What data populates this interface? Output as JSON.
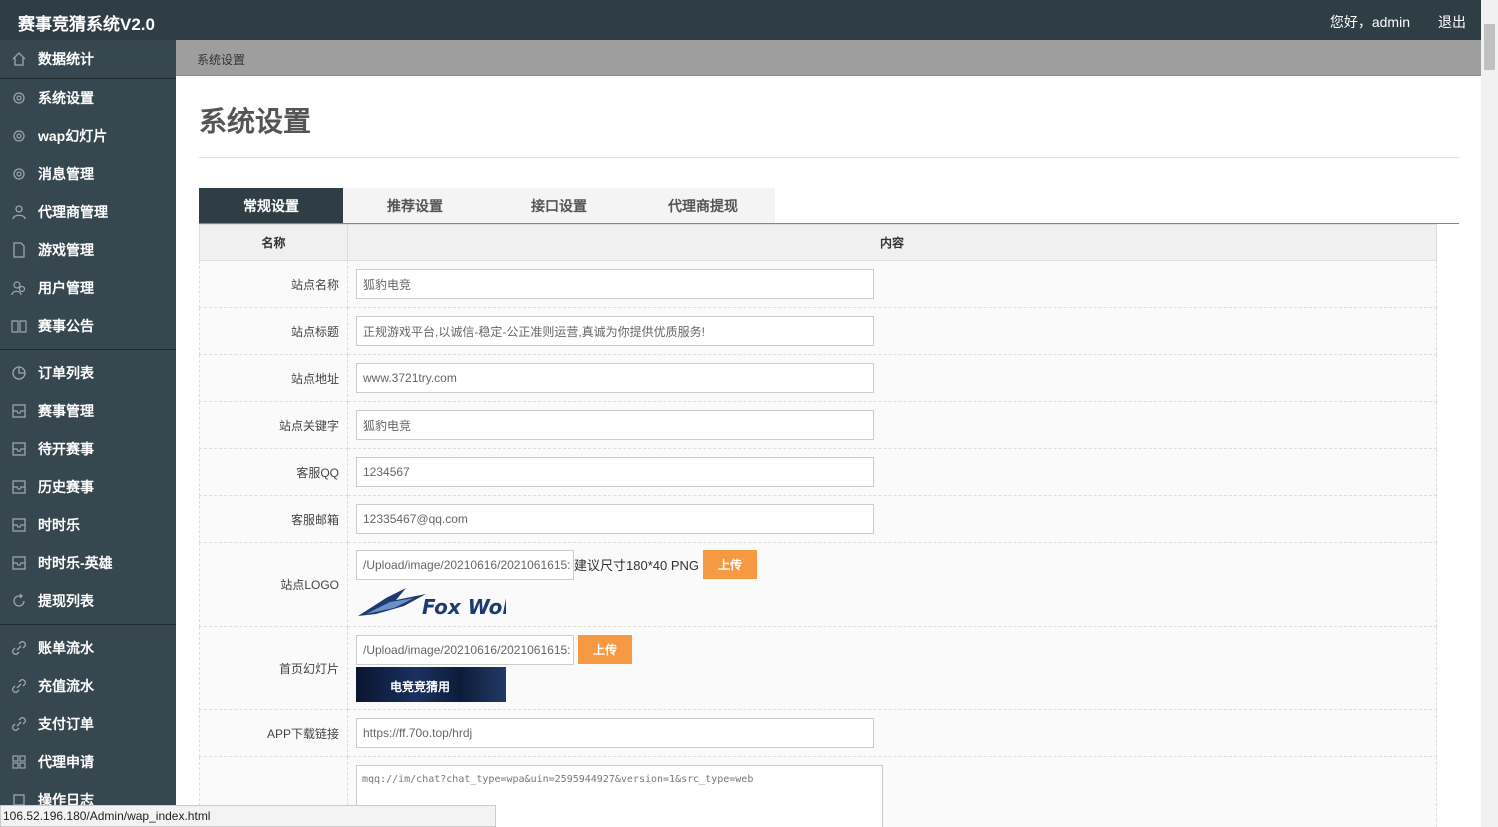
{
  "header": {
    "brand": "赛事竞猜系统V2.0",
    "greeting": "您好，admin",
    "logout": "退出"
  },
  "sidebar": {
    "groups": [
      [
        {
          "label": "数据统计",
          "icon": "home-icon"
        }
      ],
      [
        {
          "label": "系统设置",
          "icon": "gear-icon"
        },
        {
          "label": "wap幻灯片",
          "icon": "gear-icon"
        },
        {
          "label": "消息管理",
          "icon": "gear-icon"
        },
        {
          "label": "代理商管理",
          "icon": "user-icon"
        },
        {
          "label": "游戏管理",
          "icon": "file-icon"
        },
        {
          "label": "用户管理",
          "icon": "users-icon"
        },
        {
          "label": "赛事公告",
          "icon": "book-icon"
        }
      ],
      [
        {
          "label": "订单列表",
          "icon": "pie-icon"
        },
        {
          "label": "赛事管理",
          "icon": "tray-icon"
        },
        {
          "label": "待开赛事",
          "icon": "tray-icon"
        },
        {
          "label": "历史赛事",
          "icon": "tray-icon"
        },
        {
          "label": "时时乐",
          "icon": "tray-icon"
        },
        {
          "label": "时时乐-英雄",
          "icon": "tray-icon"
        },
        {
          "label": "提现列表",
          "icon": "refresh-icon"
        }
      ],
      [
        {
          "label": "账单流水",
          "icon": "link-icon"
        },
        {
          "label": "充值流水",
          "icon": "link-icon"
        },
        {
          "label": "支付订单",
          "icon": "link-icon"
        },
        {
          "label": "代理申请",
          "icon": "grid-icon"
        },
        {
          "label": "操作日志",
          "icon": "square-icon"
        }
      ]
    ]
  },
  "breadcrumb": "系统设置",
  "page_title": "系统设置",
  "tabs": [
    "常规设置",
    "推荐设置",
    "接口设置",
    "代理商提现"
  ],
  "table": {
    "col_name": "名称",
    "col_content": "内容",
    "site_name": {
      "label": "站点名称",
      "value": "狐豹电竞"
    },
    "site_title": {
      "label": "站点标题",
      "value": "正规游戏平台,以诚信-稳定-公正准则运营,真诚为你提供优质服务!"
    },
    "site_url": {
      "label": "站点地址",
      "value": "www.3721try.com"
    },
    "site_keywords": {
      "label": "站点关键字",
      "value": "狐豹电竞"
    },
    "service_qq": {
      "label": "客服QQ",
      "value": "1234567"
    },
    "service_email": {
      "label": "客服邮箱",
      "value": "12335467@qq.com"
    },
    "site_logo": {
      "label": "站点LOGO",
      "path": "/Upload/image/20210616/2021061615:",
      "hint": "建议尺寸180*40 PNG",
      "upload": "上传",
      "logo_text": "Fox Wolf"
    },
    "home_slide": {
      "label": "首页幻灯片",
      "path": "/Upload/image/20210616/2021061615:",
      "upload": "上传",
      "banner_text": "电竞竞猜用"
    },
    "app_link": {
      "label": "APP下载链接",
      "value": "https://ff.70o.top/hrdj"
    },
    "qq_link": {
      "value": "mqq://im/chat?chat_type=wpa&uin=2595944927&version=1&src_type=web"
    }
  },
  "status_url": "106.52.196.180/Admin/wap_index.html",
  "colors": {
    "header": "#2f3d44",
    "sidebar": "#37474f",
    "upload": "#f59a43"
  }
}
